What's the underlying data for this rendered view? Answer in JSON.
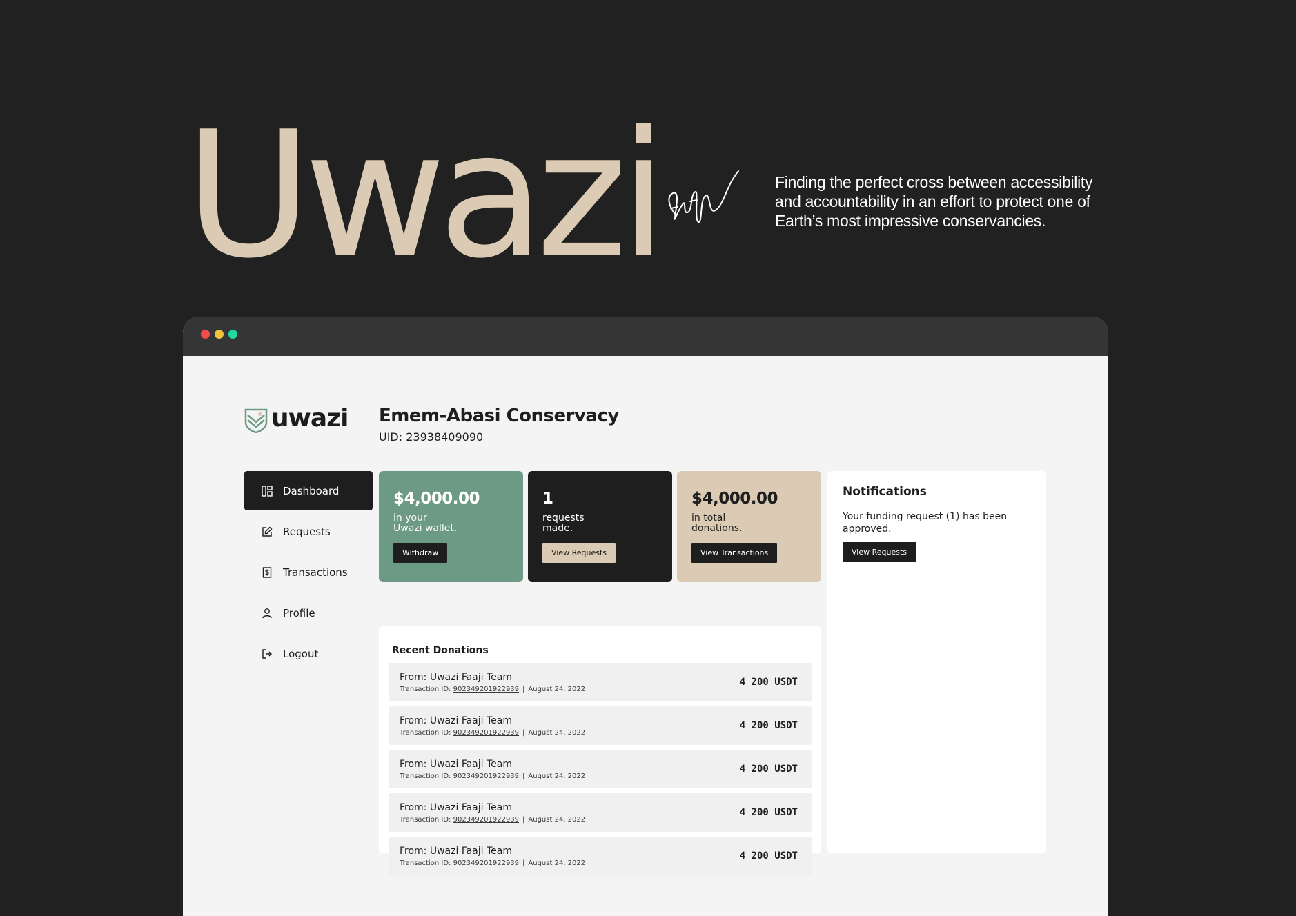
{
  "hero": {
    "title": "Uwazi",
    "tagline": "Finding the perfect cross between accessibility and accountability in an effort to protect one of Earth’s most impressive conservancies."
  },
  "colors": {
    "background": "#212121",
    "beige": "#dbcbb4",
    "green": "#6d9a84",
    "dark": "#1e1e1e",
    "window_bg": "#f4f4f4"
  },
  "app": {
    "logo_text": "uwazi",
    "org_name": "Emem-Abasi Conservacy",
    "uid": "UID: 23938409090"
  },
  "sidebar": {
    "items": [
      {
        "label": "Dashboard",
        "icon": "dashboard-icon",
        "active": true
      },
      {
        "label": "Requests",
        "icon": "edit-icon",
        "active": false
      },
      {
        "label": "Transactions",
        "icon": "receipt-dollar-icon",
        "active": false
      },
      {
        "label": "Profile",
        "icon": "user-icon",
        "active": false
      },
      {
        "label": "Logout",
        "icon": "logout-icon",
        "active": false
      }
    ]
  },
  "cards": {
    "wallet": {
      "value": "$4,000.00",
      "caption": "in your\nUwazi wallet.",
      "button": "Withdraw"
    },
    "requests": {
      "value": "1",
      "caption": "requests\nmade.",
      "button": "View Requests"
    },
    "donations": {
      "value": "$4,000.00",
      "caption": "in total\ndonations.",
      "button": "View Transactions"
    }
  },
  "notifications": {
    "title": "Notifications",
    "message": "Your funding request (1) has been approved.",
    "button": "View Requests"
  },
  "recent_donations": {
    "title": "Recent Donations",
    "rows": [
      {
        "from": "From: Uwazi Faaji Team",
        "tx_label": "Transaction ID:",
        "tx_id": "902349201922939",
        "date": "August 24, 2022",
        "amount": "4 200 USDT"
      },
      {
        "from": "From: Uwazi Faaji Team",
        "tx_label": "Transaction ID:",
        "tx_id": "902349201922939",
        "date": "August 24, 2022",
        "amount": "4 200 USDT"
      },
      {
        "from": "From: Uwazi Faaji Team",
        "tx_label": "Transaction ID:",
        "tx_id": "902349201922939",
        "date": "August 24, 2022",
        "amount": "4 200 USDT"
      },
      {
        "from": "From: Uwazi Faaji Team",
        "tx_label": "Transaction ID:",
        "tx_id": "902349201922939",
        "date": "August 24, 2022",
        "amount": "4 200 USDT"
      },
      {
        "from": "From: Uwazi Faaji Team",
        "tx_label": "Transaction ID:",
        "tx_id": "902349201922939",
        "date": "August 24, 2022",
        "amount": "4 200 USDT"
      }
    ]
  }
}
